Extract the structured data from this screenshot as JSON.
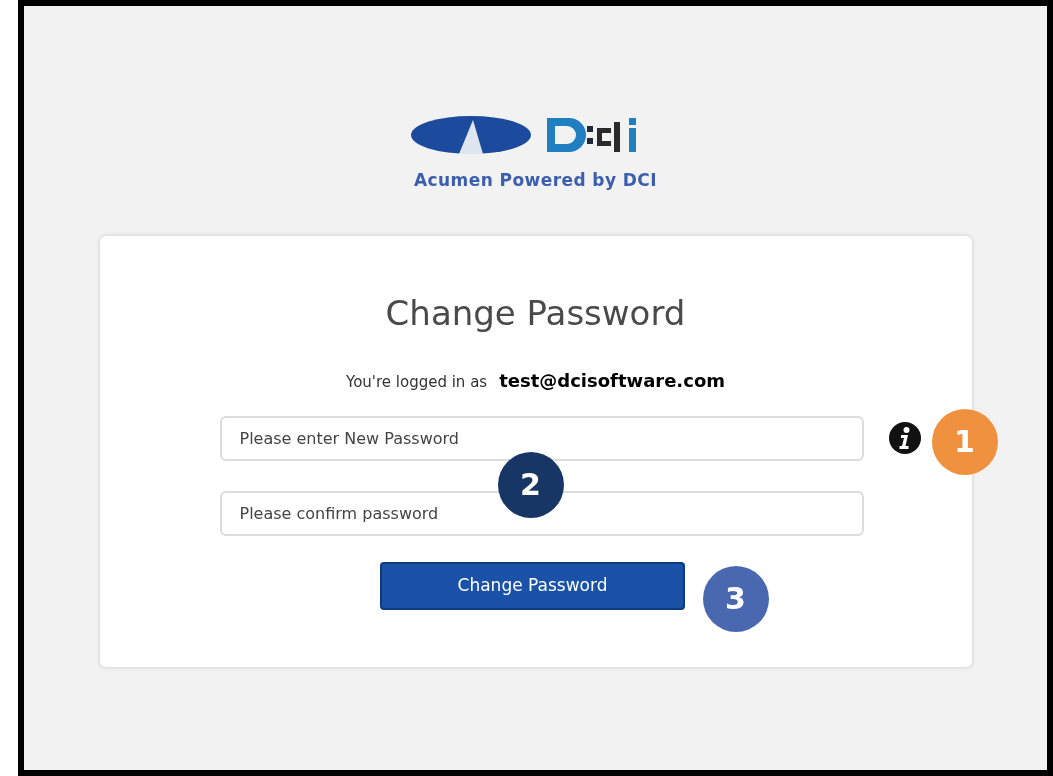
{
  "logo": {
    "tagline": "Acumen Powered by DCI"
  },
  "card": {
    "title": "Change Password",
    "logged_in_label": "You're logged in as",
    "user_email": "test@dcisoftware.com",
    "fields": [
      {
        "placeholder": "Please enter New Password",
        "info": true
      },
      {
        "placeholder": "Please confirm password",
        "info": false
      }
    ],
    "button": "Change Password"
  },
  "callouts": [
    {
      "label": "1",
      "color": "#f0913f"
    },
    {
      "label": "2",
      "color": "#173565"
    },
    {
      "label": "3",
      "color": "#4a68b0"
    }
  ]
}
